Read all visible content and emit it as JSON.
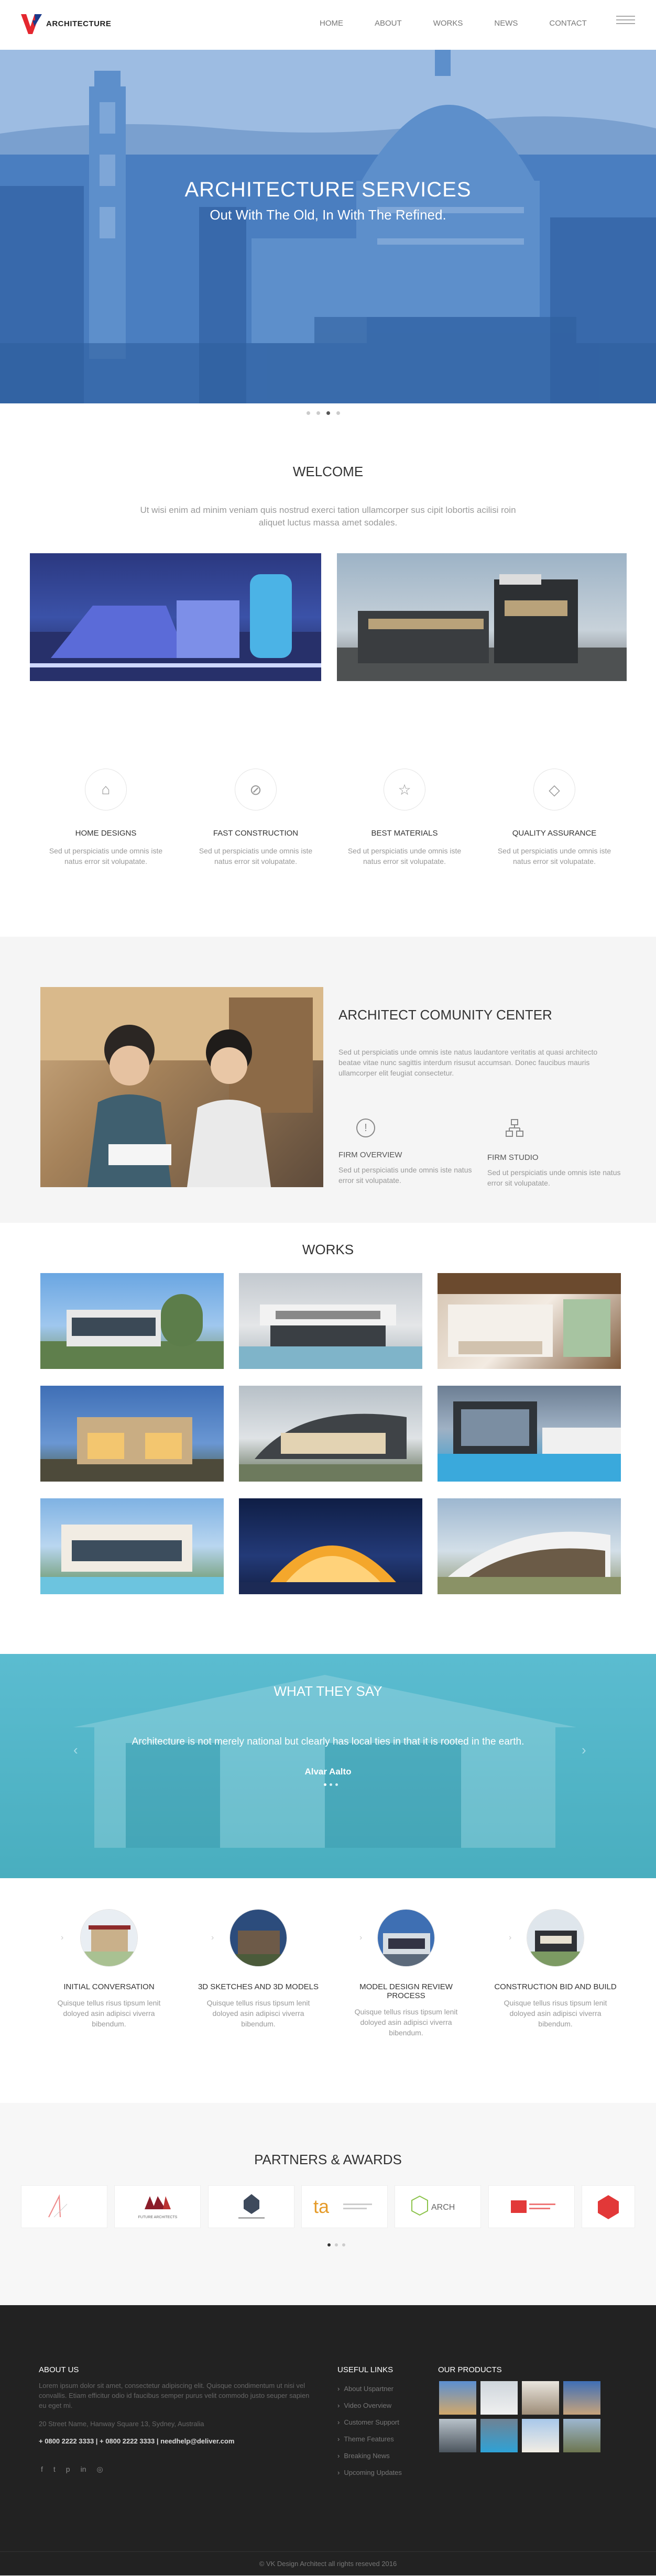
{
  "brand": {
    "name": "ARCHITECTURE"
  },
  "nav": [
    "HOME",
    "ABOUT",
    "WORKS",
    "NEWS",
    "CONTACT"
  ],
  "hero": {
    "title": "ARCHITECTURE SERVICES",
    "subtitle": "Out With The Old, In With The Refined."
  },
  "welcome": {
    "title": "WELCOME",
    "text": "Ut wisi enim ad minim veniam quis nostrud exerci tation ullamcorper sus cipit lobortis acilisi roin aliquet luctus massa amet sodales."
  },
  "services": [
    {
      "icon": "home-icon",
      "title": "HOME DESIGNS",
      "text": "Sed ut perspiciatis unde omnis iste natus error sit volupatate."
    },
    {
      "icon": "compass-icon",
      "title": "FAST CONSTRUCTION",
      "text": "Sed ut perspiciatis unde omnis iste natus error sit volupatate."
    },
    {
      "icon": "star-icon",
      "title": "BEST MATERIALS",
      "text": "Sed ut perspiciatis unde omnis iste natus error sit volupatate."
    },
    {
      "icon": "diamond-icon",
      "title": "QUALITY ASSURANCE",
      "text": "Sed ut perspiciatis unde omnis iste natus error sit volupatate."
    }
  ],
  "community": {
    "title": "ARCHITECT COMUNITY CENTER",
    "text": "Sed ut perspiciatis unde omnis iste natus laudantore veritatis at quasi architecto beatae vitae nunc sagittis interdum risusut accumsan. Donec faucibus mauris ullamcorper elit feugiat consectetur.",
    "features": [
      {
        "icon": "info-icon",
        "title": "FIRM OVERVIEW",
        "text": "Sed ut perspiciatis unde omnis iste natus error sit volupatate."
      },
      {
        "icon": "sitemap-icon",
        "title": "FIRM STUDIO",
        "text": "Sed ut perspiciatis unde omnis iste natus error sit volupatate."
      }
    ]
  },
  "works": {
    "title": "WORKS"
  },
  "testimonial": {
    "title": "WHAT THEY SAY",
    "quote": "Architecture is not merely national but clearly has local ties in that it is rooted in the earth.",
    "author": "Alvar Aalto"
  },
  "process": [
    {
      "title": "INITIAL CONVERSATION",
      "text": "Quisque tellus risus tipsum lenit doloyed asin adipisci viverra bibendum."
    },
    {
      "title": "3D SKETCHES AND 3D MODELS",
      "text": "Quisque tellus risus tipsum lenit doloyed asin adipisci viverra bibendum."
    },
    {
      "title": "MODEL DESIGN REVIEW PROCESS",
      "text": "Quisque tellus risus tipsum lenit doloyed asin adipisci viverra bibendum."
    },
    {
      "title": "CONSTRUCTION BID AND BUILD",
      "text": "Quisque tellus risus tipsum lenit doloyed asin adipisci viverra bibendum."
    }
  ],
  "partners": {
    "title": "PARTNERS & AWARDS",
    "logos": [
      "FUTURE ARCHITECTS",
      "",
      "ta",
      "ARCH",
      ""
    ]
  },
  "footer": {
    "about_title": "ABOUT US",
    "about_text": "Lorem ipsum dolor sit amet, consectetur adipiscing elit. Quisque condimentum ut nisi vel convallis. Etiam efficitur odio id faucibus semper purus velit commodo justo seuper sapien eu eget mi.",
    "address": "20 Street Name, Hanway Square 13, Sydney, Australia",
    "contact": "+ 0800 2222 3333 | + 0800 2222 3333 | needhelp@deliver.com",
    "links_title": "USEFUL LINKS",
    "links": [
      "About Uspartner",
      "Video Overview",
      "Customer Support",
      "Theme Features",
      "Breaking News",
      "Upcoming Updates"
    ],
    "products_title": "OUR PRODUCTS",
    "copyright": "© VK Design Architect all rights reseved 2016"
  }
}
